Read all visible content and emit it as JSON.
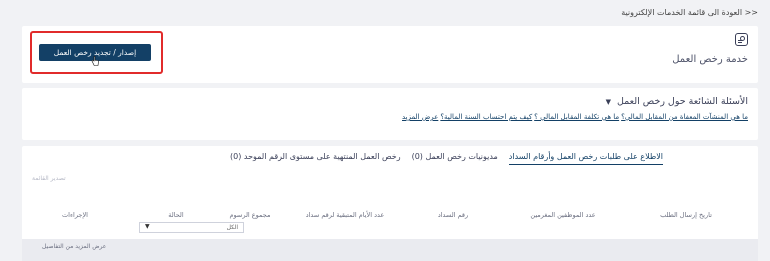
{
  "breadcrumb": {
    "back_label": "<< العودة الى قائمة الخدمات الإلكترونية"
  },
  "service": {
    "title": "خدمة رخص العمل",
    "issue_button_label": "إصدار / تجديد رخص العمل",
    "highlight_color": "#e12b2b",
    "button_color": "#134066"
  },
  "faq": {
    "title": "الأسئلة الشائعة حول رخص العمل",
    "links": [
      "ما هي المنشآت المعفاة من المقابل المالي؟",
      "ما هي تكلفة المقابل المالي ؟",
      "كيف يتم احتساب السنة المالية؟",
      "عرض المزيد"
    ]
  },
  "tabs": [
    {
      "label": "الاطلاع على طلبات رخص العمل وأرقام السداد",
      "active": true
    },
    {
      "label": "مديونيات رخص العمل (0)",
      "active": false
    },
    {
      "label": "رخص العمل المنتهية على مستوى الرقم الموحد (0)",
      "active": false
    }
  ],
  "export_label": "تصدير القائمة",
  "table": {
    "columns": [
      "تاريخ إرسال الطلب",
      "عدد الموظفين المغرمين",
      "رقم السداد",
      "عدد الأيام المتبقية لرقم سداد",
      "مجموع الرسوم",
      "الحالة",
      "الإجراءات"
    ],
    "status_filter": {
      "selected": "الكل"
    },
    "row_action_label": "عرض المزيد من التفاصيل"
  }
}
